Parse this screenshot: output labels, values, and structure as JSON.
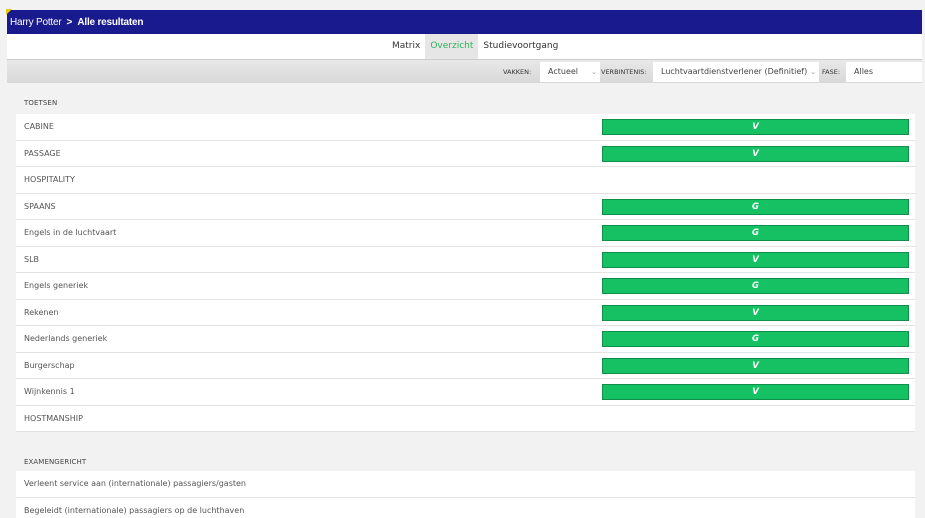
{
  "header": {
    "breadcrumb": [
      "Harry Potter",
      "Alle resultaten"
    ],
    "separator": ">"
  },
  "tabs": [
    {
      "label": "Matrix",
      "active": false
    },
    {
      "label": "Overzicht",
      "active": true
    },
    {
      "label": "Studievoortgang",
      "active": false
    }
  ],
  "filters": {
    "vakken_label": "VAKKEN:",
    "vakken_value": "Actueel",
    "verbintenis_label": "VERBINTENIS:",
    "verbintenis_value": "Luchtvaartdienstverlener (Definitief)",
    "fase_label": "FASE:",
    "fase_value": "Alles"
  },
  "toetsen": {
    "title": "TOETSEN",
    "rows": [
      {
        "label": "CABINE",
        "result": "V"
      },
      {
        "label": "PASSAGE",
        "result": "V"
      },
      {
        "label": "HOSPITALITY",
        "result": ""
      },
      {
        "label": "SPAANS",
        "result": "G"
      },
      {
        "label": "Engels in de luchtvaart",
        "result": "G"
      },
      {
        "label": "SLB",
        "result": "V"
      },
      {
        "label": "Engels generiek",
        "result": "G"
      },
      {
        "label": "Rekenen",
        "result": "V"
      },
      {
        "label": "Nederlands generiek",
        "result": "G"
      },
      {
        "label": "Burgerschap",
        "result": "V"
      },
      {
        "label": "Wijnkennis 1",
        "result": "V"
      },
      {
        "label": "HOSTMANSHIP",
        "result": ""
      }
    ]
  },
  "examengericht": {
    "title": "EXAMENGERICHT",
    "rows": [
      {
        "label": "Verleent service aan (internationale) passagiers/gasten"
      },
      {
        "label": "Begeleidt (internationale) passagiers op de luchthaven"
      }
    ]
  },
  "colors": {
    "header": "#1a1a8f",
    "pass": "#16c164",
    "active_tab": "#2bb35a"
  }
}
